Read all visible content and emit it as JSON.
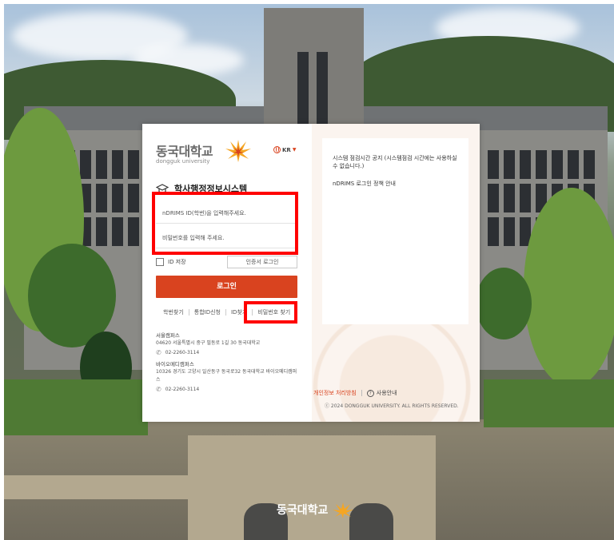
{
  "brand": {
    "name_kr": "동국대학교",
    "name_en": "dongguk university",
    "accent_color": "#d9431f",
    "logo_icon": "dongguk-flame-logo"
  },
  "language": {
    "label": "KR"
  },
  "system": {
    "title": "학사행정정보시스템",
    "icon": "graduation-cap-icon"
  },
  "login_form": {
    "id_placeholder": "nDRIMS ID(학번)을 입력해주세요.",
    "pw_placeholder": "비밀번호를 입력해 주세요.",
    "save_id_label": "ID 저장",
    "cert_login_label": "인증서 로그인",
    "login_button": "로그인"
  },
  "find_links": [
    {
      "label": "학번찾기"
    },
    {
      "label": "통합ID신청"
    },
    {
      "label": "ID찾기"
    },
    {
      "label": "비밀번호 찾기"
    }
  ],
  "campuses": [
    {
      "name": "서울캠퍼스",
      "address": "04620 서울특별시 중구 필동로 1길 30 동국대학교",
      "phone": "02-2260-3114"
    },
    {
      "name": "바이오메디캠퍼스",
      "address": "10326 경기도 고양시 일산동구 동국로32 동국대학교 바이오메디캠퍼스",
      "phone": "02-2260-3114"
    }
  ],
  "notices": [
    {
      "text": "시스템 점검시간 공지 (시스템점검 시간에는 사용하실 수 없습니다.)"
    },
    {
      "text": "nDRIMS 로그인 정책 안내"
    }
  ],
  "footer": {
    "privacy": "개인정보 처리방침",
    "guide": "사용안내",
    "copyright": "ⓒ 2024 DONGGUK UNIVERSITY. ALL RIGHTS RESERVED."
  },
  "bottom_brand": "동국대학교",
  "highlight_color": "#ff0000"
}
